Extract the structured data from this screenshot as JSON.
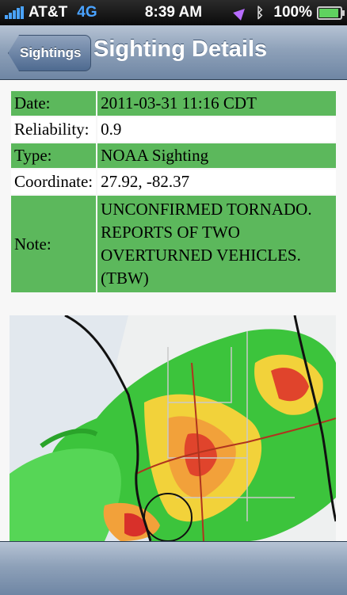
{
  "status_bar": {
    "carrier": "AT&T",
    "network": "4G",
    "time": "8:39 AM",
    "battery": "100%",
    "battery_level": 1.0
  },
  "nav": {
    "back_label": "Sightings",
    "title": "Sighting Details"
  },
  "details": {
    "date_label": "Date:",
    "date_value": "2011-03-31 11:16 CDT",
    "reliability_label": "Reliability:",
    "reliability_value": "0.9",
    "type_label": "Type:",
    "type_value": "NOAA Sighting",
    "coordinate_label": "Coordinate:",
    "coordinate_value": "27.92, -82.37",
    "note_label": "Note:",
    "note_value": "UNCONFIRMED TORNADO. REPORTS OF TWO OVERTURNED VEHICLES. (TBW)"
  },
  "colors": {
    "row_green": "#5cb85c",
    "nav_blue": "#8ea1b9",
    "signal_blue": "#4aa3ff"
  },
  "icons": {
    "location": "location-arrow-icon",
    "bluetooth": "bluetooth-icon",
    "battery": "battery-icon",
    "signal": "signal-bars-icon"
  }
}
